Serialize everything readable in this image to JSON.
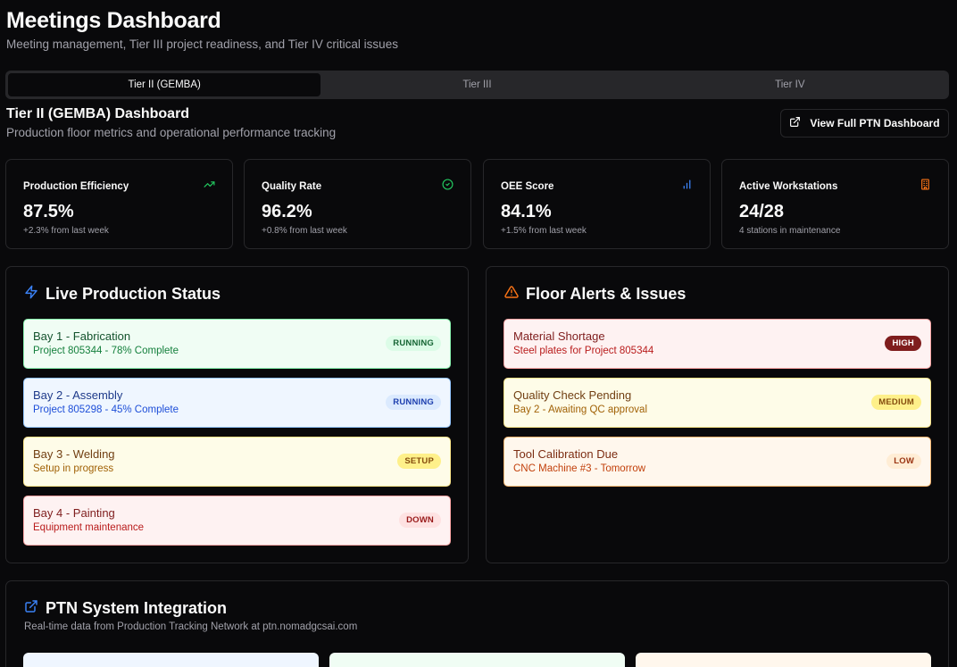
{
  "header": {
    "title": "Meetings Dashboard",
    "subtitle": "Meeting management, Tier III project readiness, and Tier IV critical issues"
  },
  "tabs": [
    {
      "label": "Tier II (GEMBA)",
      "active": true
    },
    {
      "label": "Tier III",
      "active": false
    },
    {
      "label": "Tier IV",
      "active": false
    }
  ],
  "section": {
    "title": "Tier II (GEMBA) Dashboard",
    "subtitle": "Production floor metrics and operational performance tracking",
    "ptn_button": "View Full PTN Dashboard"
  },
  "metrics": [
    {
      "label": "Production Efficiency",
      "value": "87.5%",
      "sub": "+2.3% from last week",
      "icon": "trending-up-icon",
      "icon_color": "#22c55e"
    },
    {
      "label": "Quality Rate",
      "value": "96.2%",
      "sub": "+0.8% from last week",
      "icon": "check-circle-icon",
      "icon_color": "#22c55e"
    },
    {
      "label": "OEE Score",
      "value": "84.1%",
      "sub": "+1.5% from last week",
      "icon": "bar-chart-icon",
      "icon_color": "#3b82f6"
    },
    {
      "label": "Active Workstations",
      "value": "24/28",
      "sub": "4 stations in maintenance",
      "icon": "building-icon",
      "icon_color": "#f97316"
    }
  ],
  "production": {
    "title": "Live Production Status",
    "icon": "zap-icon",
    "icon_color": "#3b82f6",
    "items": [
      {
        "title": "Bay 1 - Fabrication",
        "sub": "Project 805344 - 78% Complete",
        "status": "RUNNING",
        "tone": "green"
      },
      {
        "title": "Bay 2 - Assembly",
        "sub": "Project 805298 - 45% Complete",
        "status": "RUNNING",
        "tone": "blue"
      },
      {
        "title": "Bay 3 - Welding",
        "sub": "Setup in progress",
        "status": "SETUP",
        "tone": "yellow"
      },
      {
        "title": "Bay 4 - Painting",
        "sub": "Equipment maintenance",
        "status": "DOWN",
        "tone": "red"
      }
    ]
  },
  "alerts": {
    "title": "Floor Alerts & Issues",
    "icon": "alert-triangle-icon",
    "icon_color": "#f97316",
    "items": [
      {
        "title": "Material Shortage",
        "sub": "Steel plates for Project 805344",
        "priority": "HIGH",
        "tone": "red"
      },
      {
        "title": "Quality Check Pending",
        "sub": "Bay 2 - Awaiting QC approval",
        "priority": "MEDIUM",
        "tone": "yellow"
      },
      {
        "title": "Tool Calibration Due",
        "sub": "CNC Machine #3 - Tomorrow",
        "priority": "LOW",
        "tone": "orange"
      }
    ]
  },
  "integration": {
    "title": "PTN System Integration",
    "description": "Real-time data from Production Tracking Network at ptn.nomadgcsai.com",
    "icon": "external-link-icon",
    "icon_color": "#3b82f6"
  }
}
